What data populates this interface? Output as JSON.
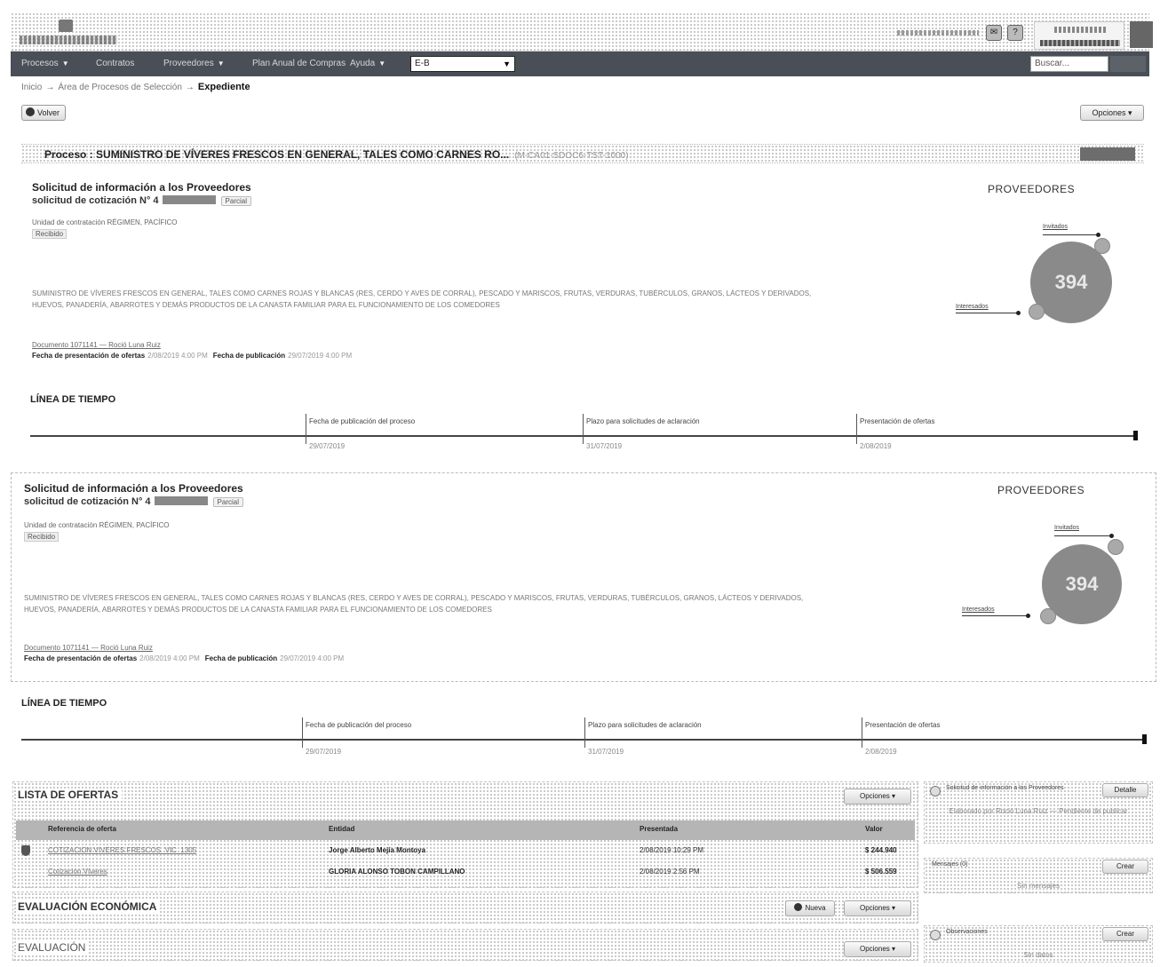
{
  "nav": {
    "items": [
      {
        "label": "Procesos",
        "caret": "▼"
      },
      {
        "label": "Contratos",
        "caret": ""
      },
      {
        "label": "Proveedores",
        "caret": "▼"
      },
      {
        "label": "Plan Anual de Compras",
        "caret": ""
      },
      {
        "label": "Ayuda",
        "caret": "▼"
      }
    ],
    "select_value": "E-B",
    "search_placeholder": "Buscar..."
  },
  "breadcrumb": {
    "items": [
      "Inicio",
      "Área de Procesos de Selección"
    ],
    "current": "Expediente"
  },
  "toolbar": {
    "back_label": "Volver",
    "options_label": "Opciones ▾"
  },
  "process": {
    "title": "Proceso : SUMINISTRO DE VÍVERES FRESCOS EN GENERAL, TALES COMO CARNES RO...",
    "code": "(M-CA01-SDOC6-TST-1000)"
  },
  "solicitud": {
    "title": "Solicitud de información a los Proveedores",
    "subtitle": "solicitud de cotización N° 4",
    "status": "Parcial",
    "unit": "Unidad de contratación RÉGIMEN, PACÍFICO",
    "unit_tag": "Recibido",
    "description": "SUMINISTRO DE VÍVERES FRESCOS EN GENERAL, TALES COMO CARNES ROJAS Y BLANCAS (RES, CERDO Y AVES DE CORRAL), PESCADO Y MARISCOS, FRUTAS, VERDURAS, TUBÉRCULOS, GRANOS, LÁCTEOS Y DERIVADOS, HUEVOS, PANADERÍA, ABARROTES Y DEMÁS PRODUCTOS DE LA CANASTA FAMILIAR PARA EL FUNCIONAMIENTO DE LOS COMEDORES",
    "contact": "Documento 1071141 — Roció Luna Ruiz",
    "date_offers_label": "Fecha de presentación de ofertas",
    "date_offers_value": "2/08/2019 4:00 PM",
    "date_pub_label": "Fecha de publicación",
    "date_pub_value": "29/07/2019 4:00 PM"
  },
  "providers": {
    "title": "PROVEEDORES",
    "count": "394",
    "invited_label": "Invitados",
    "interested_label": "Interesados"
  },
  "timeline": {
    "heading": "LÍNEA DE TIEMPO",
    "events": [
      {
        "label": "Fecha de publicación del proceso",
        "date": "29/07/2019"
      },
      {
        "label": "Plazo para solicitudes de aclaración",
        "date": "31/07/2019"
      },
      {
        "label": "Presentación de ofertas",
        "date": "2/08/2019"
      }
    ]
  },
  "offers": {
    "title": "LISTA DE OFERTAS",
    "options_label": "Opciones ▾",
    "columns": [
      "Referencia de oferta",
      "Entidad",
      "Presentada",
      "Valor"
    ],
    "rows": [
      {
        "ref": "COTIZACION VIVERES FRESCOS_VIC_1305",
        "entity": "Jorge Alberto Mejía Montoya",
        "date": "2/08/2019 10:29 PM",
        "value": "$ 244.940"
      },
      {
        "ref": "Cotización Víveres",
        "entity": "GLORIA ALONSO TOBON CAMPILLANO",
        "date": "2/08/2019 2:56 PM",
        "value": "$ 506.559"
      }
    ]
  },
  "evaluation": {
    "title": "EVALUACIÓN ECONÓMICA",
    "btn_label": "Nueva",
    "options_label": "Opciones ▾"
  },
  "evaluation2": {
    "title": "EVALUACIÓN",
    "options_label": "Opciones ▾"
  },
  "side": {
    "card1_title": "Solicitud de información a los Proveedores",
    "card1_btn": "Detalle",
    "card1_text": "Elaborado por Roció Luna Ruiz — Pendiente de publicar",
    "card2_title": "Mensajes (0)",
    "card2_btn": "Crear",
    "card2_text": "Sin mensajes",
    "card3_title": "Observaciones",
    "card3_btn": "Crear",
    "card3_text": "Sin datos"
  },
  "colors": {
    "navbar": "#4a4f57",
    "circle": "#8a8a8a",
    "table_header": "#b5b5b5"
  }
}
